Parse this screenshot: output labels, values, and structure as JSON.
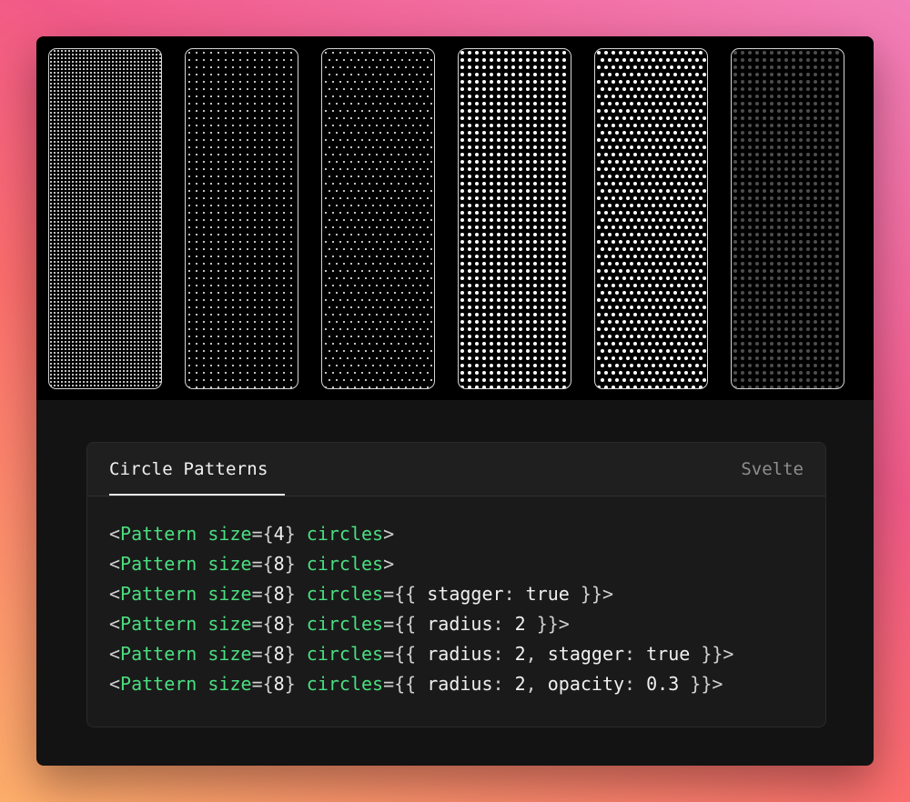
{
  "swatches": [
    {
      "name": "pattern-size-4",
      "size": 4,
      "radius": 1,
      "stagger": false,
      "opacity": 1
    },
    {
      "name": "pattern-size-8",
      "size": 8,
      "radius": 1,
      "stagger": false,
      "opacity": 1
    },
    {
      "name": "pattern-size-8-stagger",
      "size": 8,
      "radius": 1,
      "stagger": true,
      "opacity": 1
    },
    {
      "name": "pattern-size-8-radius-2",
      "size": 8,
      "radius": 2,
      "stagger": false,
      "opacity": 1
    },
    {
      "name": "pattern-size-8-radius-2-stagger",
      "size": 8,
      "radius": 2,
      "stagger": true,
      "opacity": 1
    },
    {
      "name": "pattern-size-8-radius-2-opacity",
      "size": 8,
      "radius": 2,
      "stagger": false,
      "opacity": 0.3
    }
  ],
  "card": {
    "tab_label": "Circle Patterns",
    "language": "Svelte"
  },
  "code_lines": [
    [
      {
        "t": "<",
        "c": "p"
      },
      {
        "t": "Pattern",
        "c": "tag"
      },
      {
        "t": " ",
        "c": "p"
      },
      {
        "t": "size",
        "c": "attr"
      },
      {
        "t": "={",
        "c": "p"
      },
      {
        "t": "4",
        "c": "val"
      },
      {
        "t": "} ",
        "c": "p"
      },
      {
        "t": "circles",
        "c": "attr"
      },
      {
        "t": ">",
        "c": "p"
      }
    ],
    [
      {
        "t": "<",
        "c": "p"
      },
      {
        "t": "Pattern",
        "c": "tag"
      },
      {
        "t": " ",
        "c": "p"
      },
      {
        "t": "size",
        "c": "attr"
      },
      {
        "t": "={",
        "c": "p"
      },
      {
        "t": "8",
        "c": "val"
      },
      {
        "t": "} ",
        "c": "p"
      },
      {
        "t": "circles",
        "c": "attr"
      },
      {
        "t": ">",
        "c": "p"
      }
    ],
    [
      {
        "t": "<",
        "c": "p"
      },
      {
        "t": "Pattern",
        "c": "tag"
      },
      {
        "t": " ",
        "c": "p"
      },
      {
        "t": "size",
        "c": "attr"
      },
      {
        "t": "={",
        "c": "p"
      },
      {
        "t": "8",
        "c": "val"
      },
      {
        "t": "} ",
        "c": "p"
      },
      {
        "t": "circles",
        "c": "attr"
      },
      {
        "t": "={{ ",
        "c": "p"
      },
      {
        "t": "stagger",
        "c": "key"
      },
      {
        "t": ": ",
        "c": "p"
      },
      {
        "t": "true",
        "c": "val"
      },
      {
        "t": " }}>",
        "c": "p"
      }
    ],
    [
      {
        "t": "<",
        "c": "p"
      },
      {
        "t": "Pattern",
        "c": "tag"
      },
      {
        "t": " ",
        "c": "p"
      },
      {
        "t": "size",
        "c": "attr"
      },
      {
        "t": "={",
        "c": "p"
      },
      {
        "t": "8",
        "c": "val"
      },
      {
        "t": "} ",
        "c": "p"
      },
      {
        "t": "circles",
        "c": "attr"
      },
      {
        "t": "={{ ",
        "c": "p"
      },
      {
        "t": "radius",
        "c": "key"
      },
      {
        "t": ": ",
        "c": "p"
      },
      {
        "t": "2",
        "c": "val"
      },
      {
        "t": " }}>",
        "c": "p"
      }
    ],
    [
      {
        "t": "<",
        "c": "p"
      },
      {
        "t": "Pattern",
        "c": "tag"
      },
      {
        "t": " ",
        "c": "p"
      },
      {
        "t": "size",
        "c": "attr"
      },
      {
        "t": "={",
        "c": "p"
      },
      {
        "t": "8",
        "c": "val"
      },
      {
        "t": "} ",
        "c": "p"
      },
      {
        "t": "circles",
        "c": "attr"
      },
      {
        "t": "={{ ",
        "c": "p"
      },
      {
        "t": "radius",
        "c": "key"
      },
      {
        "t": ": ",
        "c": "p"
      },
      {
        "t": "2",
        "c": "val"
      },
      {
        "t": ", ",
        "c": "p"
      },
      {
        "t": "stagger",
        "c": "key"
      },
      {
        "t": ": ",
        "c": "p"
      },
      {
        "t": "true",
        "c": "val"
      },
      {
        "t": " }}>",
        "c": "p"
      }
    ],
    [
      {
        "t": "<",
        "c": "p"
      },
      {
        "t": "Pattern",
        "c": "tag"
      },
      {
        "t": " ",
        "c": "p"
      },
      {
        "t": "size",
        "c": "attr"
      },
      {
        "t": "={",
        "c": "p"
      },
      {
        "t": "8",
        "c": "val"
      },
      {
        "t": "} ",
        "c": "p"
      },
      {
        "t": "circles",
        "c": "attr"
      },
      {
        "t": "={{ ",
        "c": "p"
      },
      {
        "t": "radius",
        "c": "key"
      },
      {
        "t": ": ",
        "c": "p"
      },
      {
        "t": "2",
        "c": "val"
      },
      {
        "t": ", ",
        "c": "p"
      },
      {
        "t": "opacity",
        "c": "key"
      },
      {
        "t": ": ",
        "c": "p"
      },
      {
        "t": "0.3",
        "c": "val"
      },
      {
        "t": " }}>",
        "c": "p"
      }
    ]
  ],
  "colors": {
    "dot": "#ffffff",
    "keyword": "#4ade80",
    "text": "#ececec"
  }
}
